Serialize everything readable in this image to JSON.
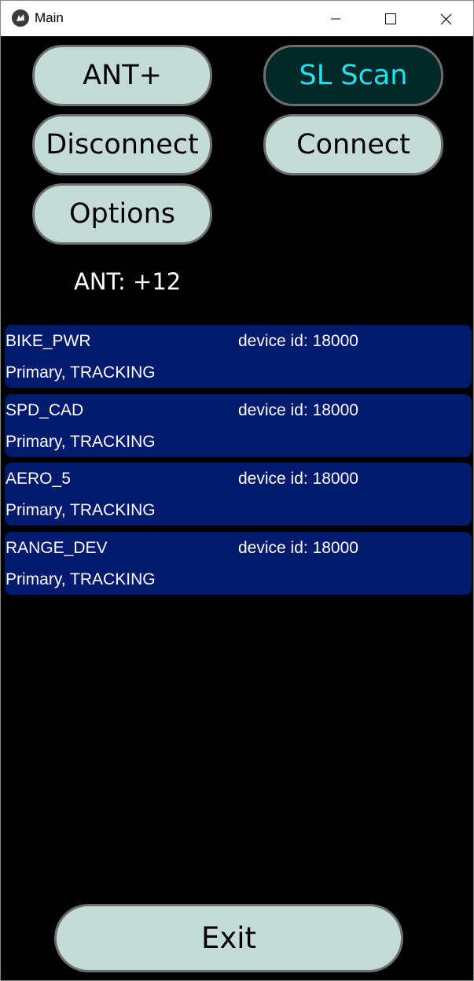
{
  "window": {
    "title": "Main",
    "icon": "kivy-app-icon",
    "controls": [
      "minimize-icon",
      "maximize-icon",
      "close-icon"
    ]
  },
  "buttons": {
    "ant_plus": "ANT+",
    "sl_scan": "SL Scan",
    "disconnect": "Disconnect",
    "connect": "Connect",
    "options": "Options",
    "exit": "Exit"
  },
  "status": {
    "text": "ANT: +12"
  },
  "devices": [
    {
      "name": "BIKE_PWR",
      "device_id": "device id: 18000",
      "state": "Primary, TRACKING"
    },
    {
      "name": "SPD_CAD",
      "device_id": "device id: 18000",
      "state": "Primary, TRACKING"
    },
    {
      "name": "AERO_5",
      "device_id": "device id: 18000",
      "state": "Primary, TRACKING"
    },
    {
      "name": "RANGE_DEV",
      "device_id": "device id: 18000",
      "state": "Primary, TRACKING"
    }
  ],
  "colors": {
    "button_bg": "#c4dbd8",
    "button_active_bg": "#022828",
    "button_active_text": "#1fe3ee",
    "device_row_bg": "#001a6e",
    "background": "#000000"
  }
}
